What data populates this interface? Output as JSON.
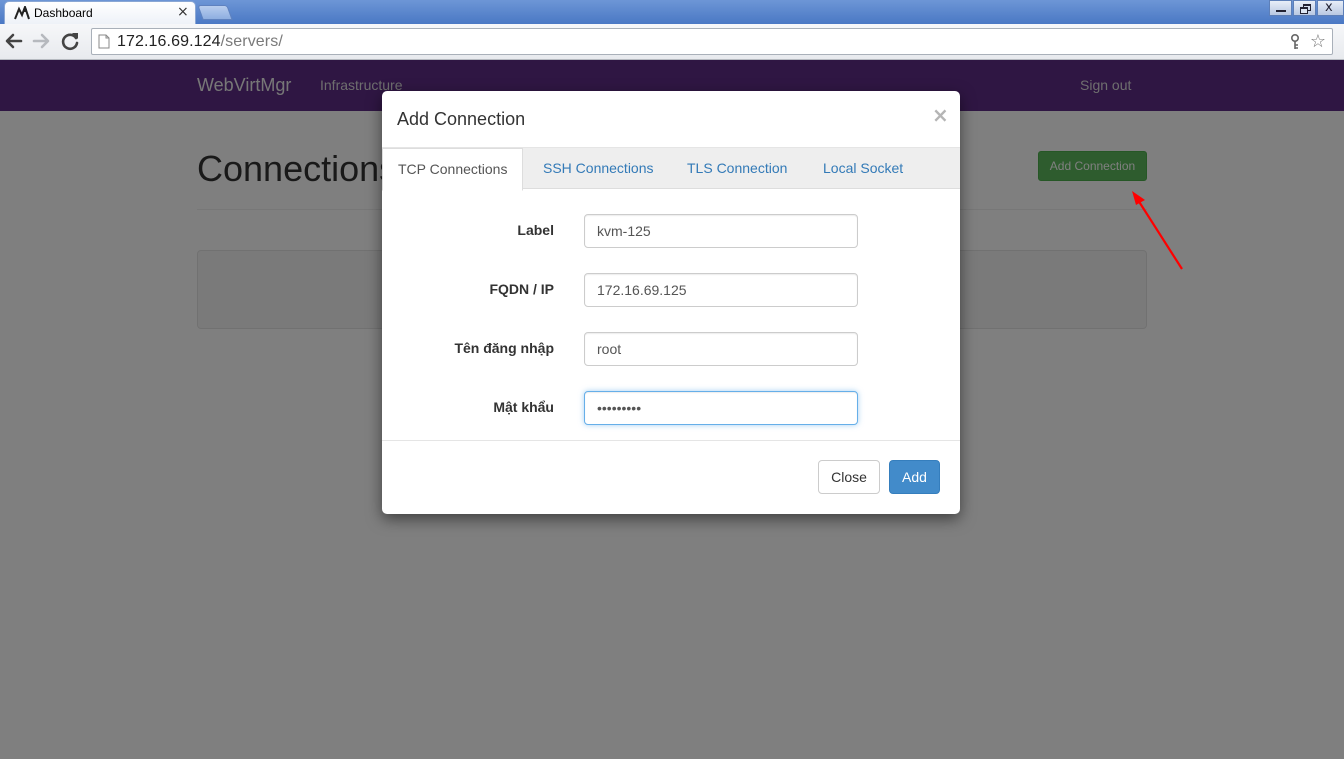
{
  "browser": {
    "tab_title": "Dashboard",
    "tab_close": "×",
    "url_host": "172.16.69.124",
    "url_path": "/servers/",
    "window_controls": {
      "close": "x"
    }
  },
  "navbar": {
    "brand": "WebVirtMgr",
    "infrastructure": "Infrastructure",
    "sign_out": "Sign out"
  },
  "page": {
    "heading": "Connections",
    "add_connection_button": "Add Connection"
  },
  "modal": {
    "title": "Add Connection",
    "close_glyph": "×",
    "tabs": [
      {
        "label": "TCP Connections",
        "active": true
      },
      {
        "label": "SSH Connections",
        "active": false
      },
      {
        "label": "TLS Connection",
        "active": false
      },
      {
        "label": "Local Socket",
        "active": false
      }
    ],
    "fields": {
      "label": {
        "label": "Label",
        "value": "kvm-125"
      },
      "fqdn": {
        "label": "FQDN / IP",
        "value": "172.16.69.125"
      },
      "username": {
        "label": "Tên đăng nhập",
        "value": "root"
      },
      "password": {
        "label": "Mật khẩu",
        "value": "•••••••••"
      }
    },
    "buttons": {
      "close": "Close",
      "add": "Add"
    }
  },
  "colors": {
    "navbar": "#5e2c87",
    "add_connection_button": "#5cb85c",
    "primary_button": "#428bca",
    "tab_link": "#337ab7",
    "annotation_arrow": "#ff0000"
  }
}
